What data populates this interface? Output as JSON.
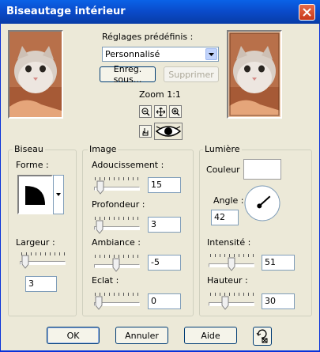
{
  "window": {
    "title": "Biseautage intérieur"
  },
  "presets": {
    "label": "Réglages prédéfinis :",
    "selected": "Personnalisé",
    "save_label": "Enreg. sous...",
    "delete_label": "Supprimer"
  },
  "zoom": {
    "label": "Zoom 1:1"
  },
  "bevel": {
    "group_label": "Biseau",
    "shape_label": "Forme :",
    "width_label": "Largeur :",
    "width_value": "3"
  },
  "image": {
    "group_label": "Image",
    "smoothness_label": "Adoucissement :",
    "smoothness_value": "15",
    "depth_label": "Profondeur :",
    "depth_value": "3",
    "ambience_label": "Ambiance :",
    "ambience_value": "-5",
    "shininess_label": "Eclat :",
    "shininess_value": "0"
  },
  "light": {
    "group_label": "Lumière",
    "color_label": "Couleur :",
    "color_value": "#FFFFFF",
    "angle_label": "Angle :",
    "angle_value": "42",
    "intensity_label": "Intensité :",
    "intensity_value": "51",
    "height_label": "Hauteur :",
    "height_value": "30"
  },
  "footer": {
    "ok_label": "OK",
    "cancel_label": "Annuler",
    "help_label": "Aide"
  }
}
